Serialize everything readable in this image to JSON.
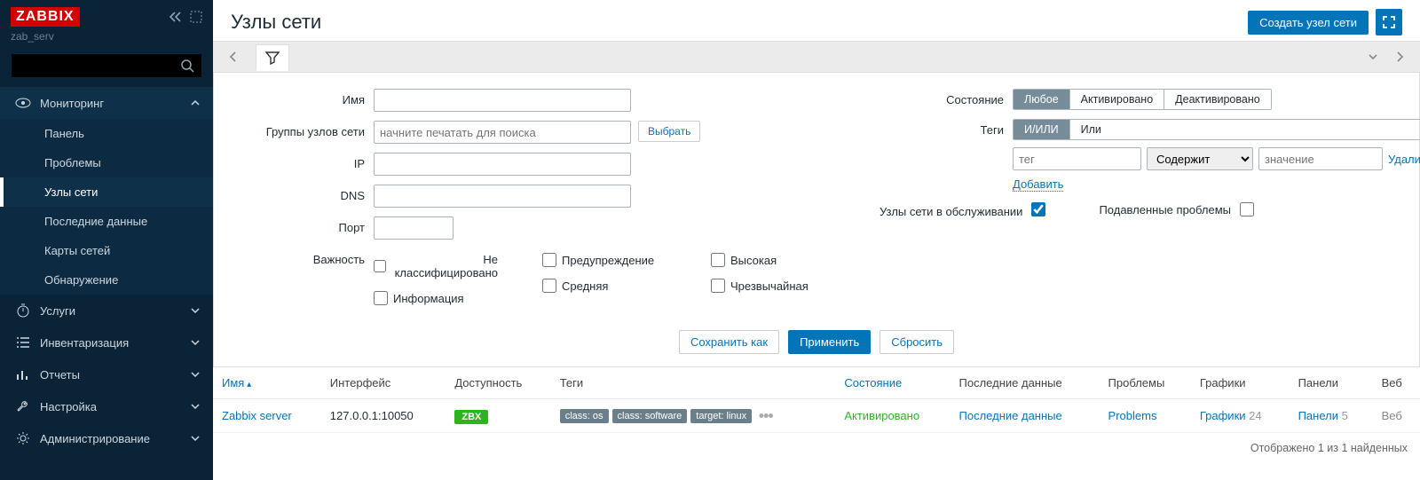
{
  "app": {
    "logo": "ZABBIX",
    "server_name": "zab_serv"
  },
  "page": {
    "title": "Узлы сети",
    "create_btn": "Создать узел сети"
  },
  "sidebar": {
    "items": [
      {
        "label": "Мониторинг",
        "expanded": true,
        "active": true,
        "children": [
          {
            "label": "Панель"
          },
          {
            "label": "Проблемы"
          },
          {
            "label": "Узлы сети",
            "active": true
          },
          {
            "label": "Последние данные"
          },
          {
            "label": "Карты сетей"
          },
          {
            "label": "Обнаружение"
          }
        ]
      },
      {
        "label": "Услуги"
      },
      {
        "label": "Инвентаризация"
      },
      {
        "label": "Отчеты"
      },
      {
        "label": "Настройка"
      },
      {
        "label": "Администрирование"
      }
    ]
  },
  "filter": {
    "labels": {
      "name": "Имя",
      "host_groups": "Группы узлов сети",
      "ip": "IP",
      "dns": "DNS",
      "port": "Порт",
      "severity": "Важность",
      "status": "Состояние",
      "tags_lbl": "Теги",
      "hosts_maintenance": "Узлы сети в обслуживании",
      "suppressed": "Подавленные проблемы"
    },
    "placeholders": {
      "host_groups": "начните печатать для поиска",
      "tag_name": "тег",
      "tag_value": "значение"
    },
    "select_btn": "Выбрать",
    "status_opts": [
      "Любое",
      "Активировано",
      "Деактивировано"
    ],
    "tag_mode_opts": [
      "И/ИЛИ",
      "Или"
    ],
    "tag_op_opts": [
      "Содержит"
    ],
    "tag_add": "Добавить",
    "tag_remove": "Удалить",
    "severity_opts": [
      "Не классифицировано",
      "Информация",
      "Предупреждение",
      "Средняя",
      "Высокая",
      "Чрезвычайная"
    ],
    "actions": {
      "save_as": "Сохранить как",
      "apply": "Применить",
      "reset": "Сбросить"
    }
  },
  "table": {
    "headers": {
      "name": "Имя",
      "interface": "Интерфейс",
      "availability": "Доступность",
      "tags": "Теги",
      "status": "Состояние",
      "latest": "Последние данные",
      "problems": "Проблемы",
      "graphs": "Графики",
      "dashboards": "Панели",
      "web": "Веб"
    },
    "rows": [
      {
        "name": "Zabbix server",
        "interface": "127.0.0.1:10050",
        "avail_badge": "ZBX",
        "tags": [
          "class: os",
          "class: software",
          "target: linux"
        ],
        "status": "Активировано",
        "latest": "Последние данные",
        "problems": "Problems",
        "graphs": "Графики",
        "graphs_n": "24",
        "dashboards": "Панели",
        "dashboards_n": "5",
        "web": "Веб"
      }
    ],
    "footer": "Отображено 1 из 1 найденных"
  }
}
